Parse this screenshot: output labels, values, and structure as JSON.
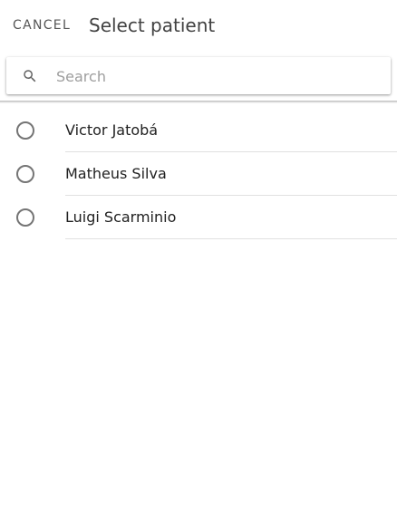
{
  "header": {
    "cancel_label": "CANCEL",
    "title": "Select patient"
  },
  "search": {
    "placeholder": "Search",
    "value": "",
    "icon": "search-icon"
  },
  "patients": [
    {
      "name": "Victor Jatobá",
      "selected": false
    },
    {
      "name": "Matheus Silva",
      "selected": false
    },
    {
      "name": "Luigi Scarminio",
      "selected": false
    }
  ],
  "colors": {
    "icon": "#757575",
    "text_primary": "#212121",
    "divider": "#e0e0e0"
  }
}
